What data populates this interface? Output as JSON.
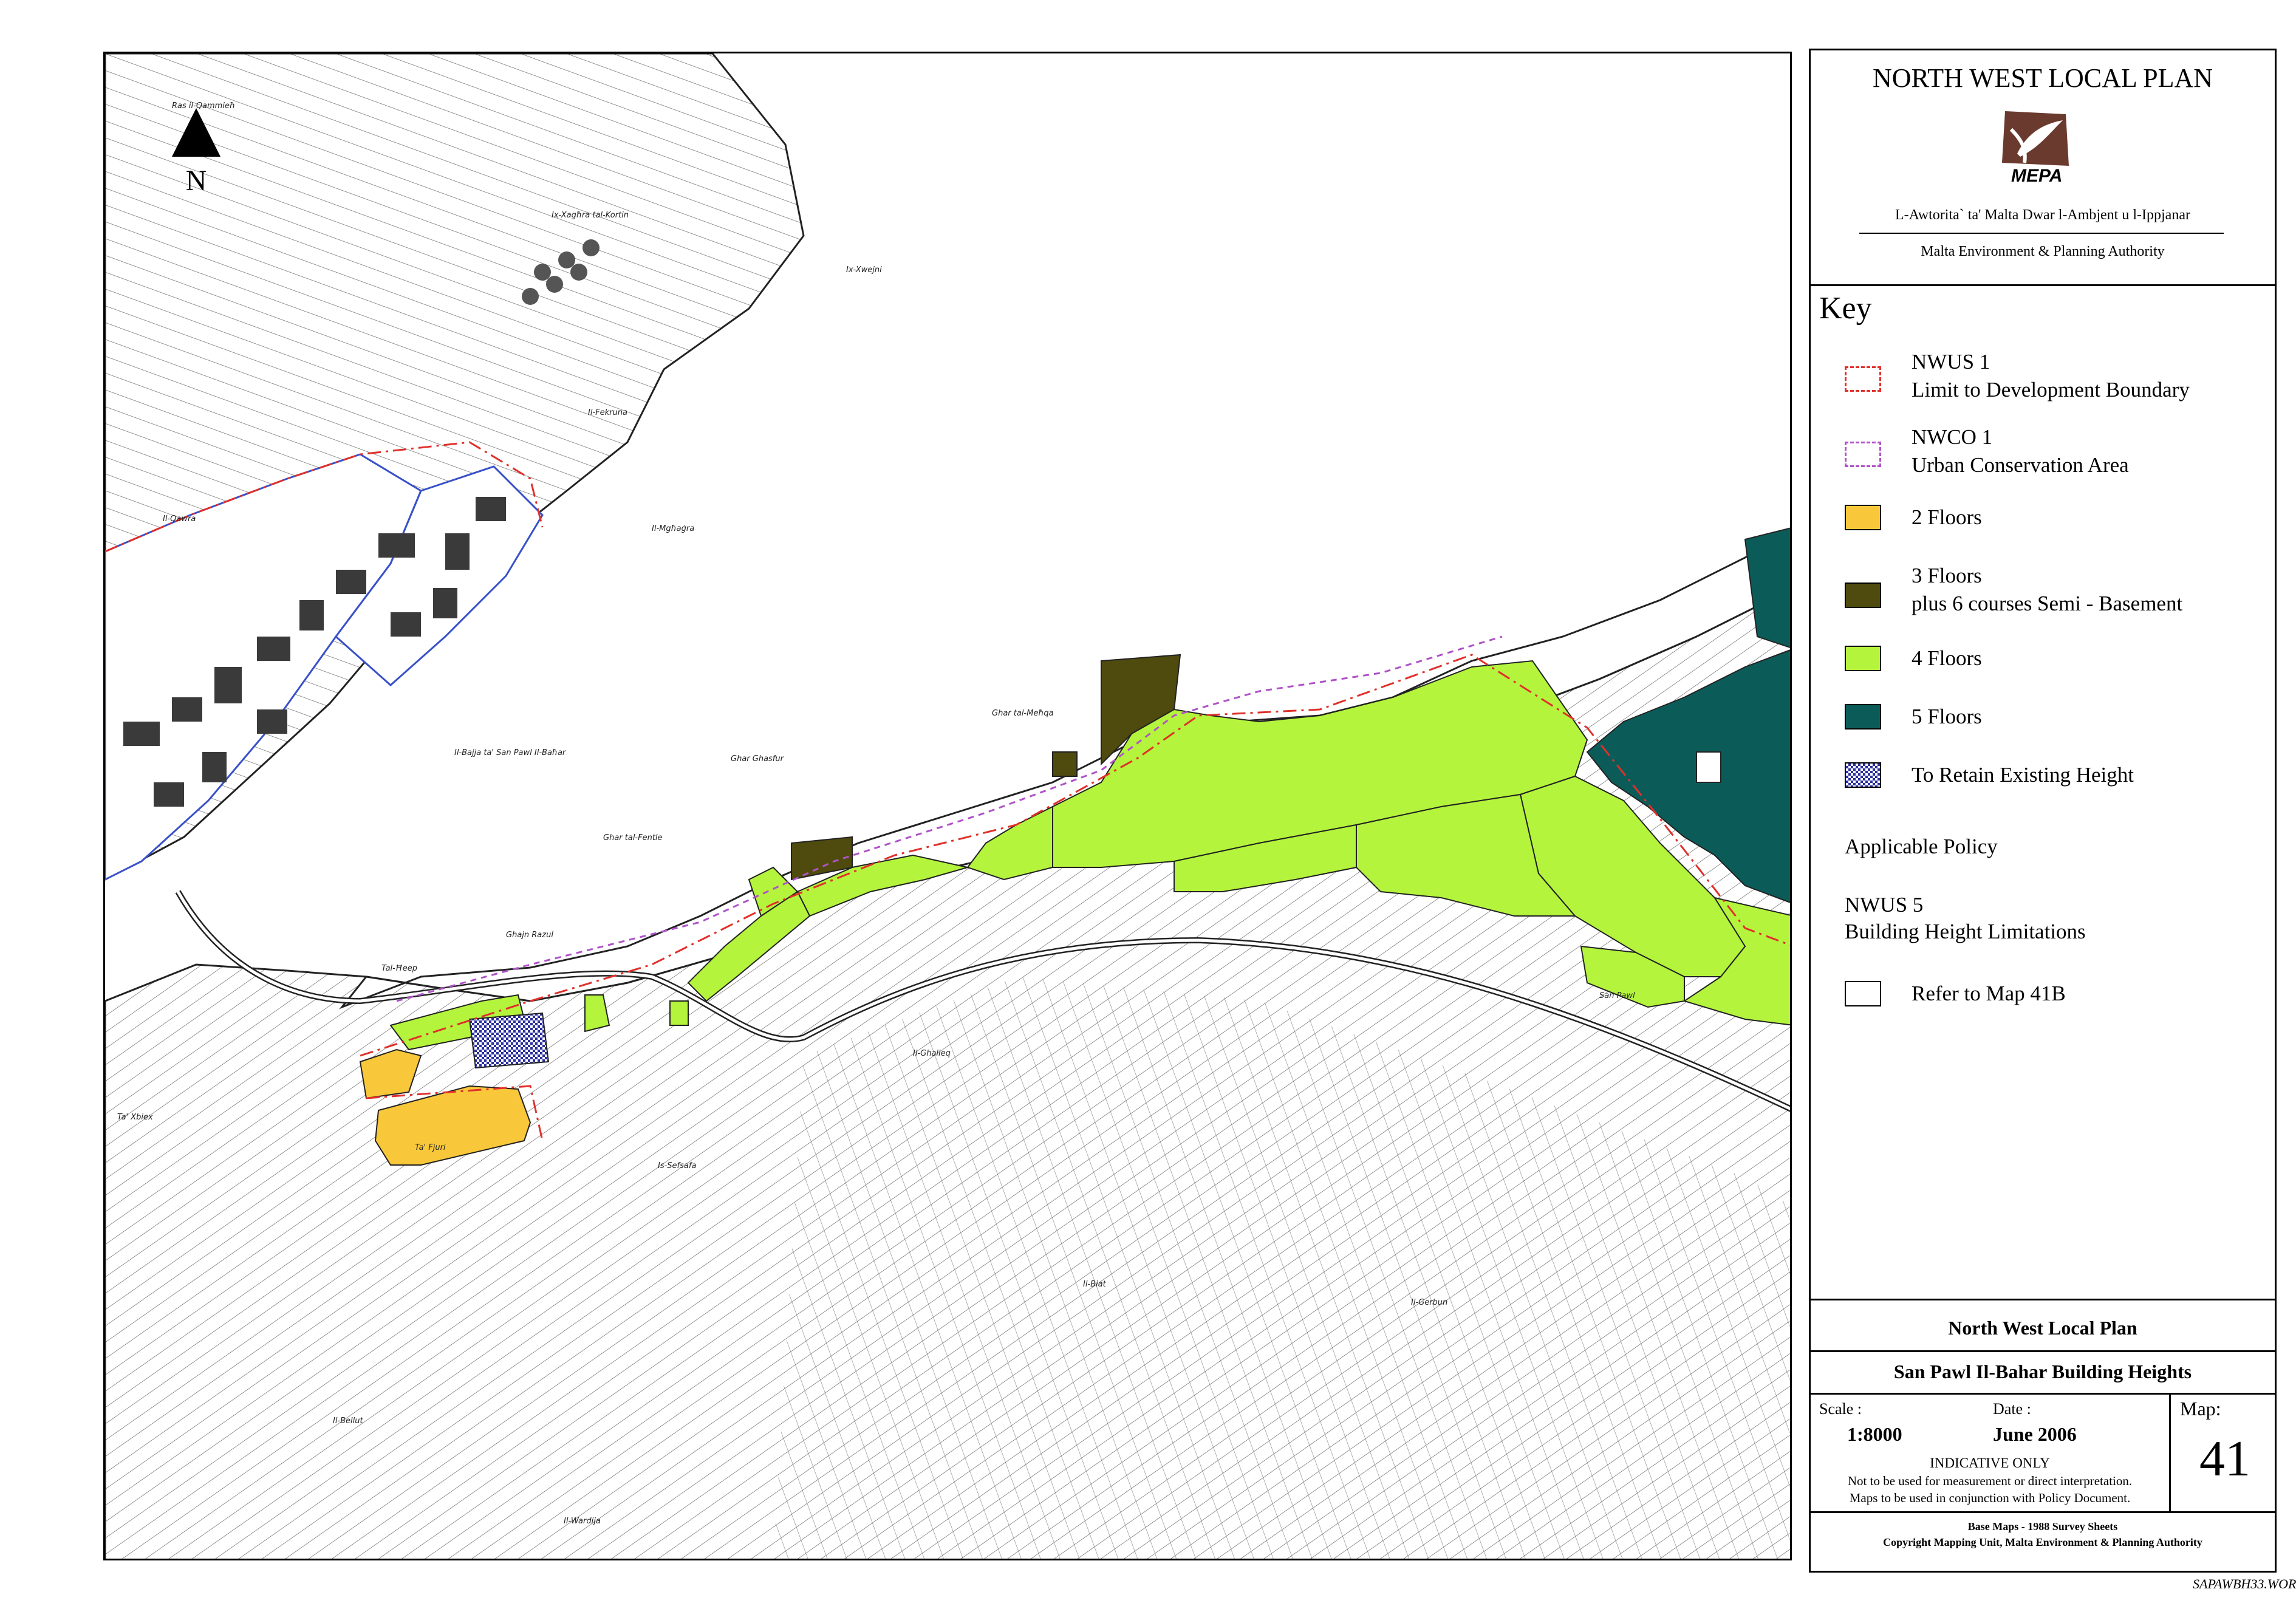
{
  "title_block": {
    "title": "NORTH WEST LOCAL PLAN",
    "logo_text": "MEPA",
    "authority_mt": "L-Awtorita` ta' Malta Dwar l-Ambjent u l-Ippjanar",
    "authority_en": "Malta Environment & Planning Authority"
  },
  "key": {
    "heading": "Key",
    "items": [
      {
        "code": "NWUS 1",
        "label": "Limit to Development Boundary",
        "style": "red-dashdot",
        "color": "#e0302a"
      },
      {
        "code": "NWCO 1",
        "label": "Urban Conservation Area",
        "style": "purple-dashed",
        "color": "#b052c8"
      },
      {
        "code": "",
        "label": "2 Floors",
        "style": "fill",
        "color": "#f9c73a"
      },
      {
        "code": "3 Floors",
        "label": "plus 6 courses Semi - Basement",
        "style": "fill",
        "color": "#4f4a0e"
      },
      {
        "code": "",
        "label": "4 Floors",
        "style": "fill",
        "color": "#b4f43c"
      },
      {
        "code": "",
        "label": "5 Floors",
        "style": "fill",
        "color": "#0b5c59"
      },
      {
        "code": "",
        "label": "To Retain Existing Height",
        "style": "checker",
        "color": "#2a2e9e"
      }
    ],
    "policy_heading": "Applicable Policy",
    "policy_code": "NWUS 5",
    "policy_label": "Building Height Limitations",
    "refer_label": "Refer to Map 41B"
  },
  "footer": {
    "plan_title": "North West Local Plan",
    "map_title": "San Pawl Il-Bahar Building Heights",
    "scale_label": "Scale :",
    "scale_value": "1:8000",
    "date_label": "Date :",
    "date_value": "June 2006",
    "map_label": "Map:",
    "map_number": "41",
    "indicative": "INDICATIVE ONLY",
    "note1": "Not to be used for measurement or direct interpretation.",
    "note2": "Maps to be used in conjunction with Policy Document.",
    "base_maps": "Base Maps - 1988 Survey Sheets",
    "copyright": "Copyright Mapping Unit, Malta Environment & Planning Authority"
  },
  "drawing_ref": "SAPAWBH33.WOR",
  "north_label": "N",
  "place_names": [
    "Ix-Xagħra tal-Kortin",
    "Il-Bajja ta' San Pawl Il-Baħar",
    "Ras il-Qammieħ",
    "Il-Ghalleq",
    "Il-Biat",
    "Il-Gerbun",
    "Is-Sefsafa",
    "Ta' Fjuri",
    "Il-Bellut",
    "Il-Wardija",
    "Ta' Xbiex",
    "Il-Qawra",
    "Ghar Ghasfur",
    "Ghar tal-Fentle",
    "Ghajn Razul",
    "Tal-Ħeep",
    "Ix-Xwejni",
    "Il-Fekruna",
    "Il-Mgħaġra",
    "Ghar tal-Meħqa",
    "San Pawl"
  ]
}
